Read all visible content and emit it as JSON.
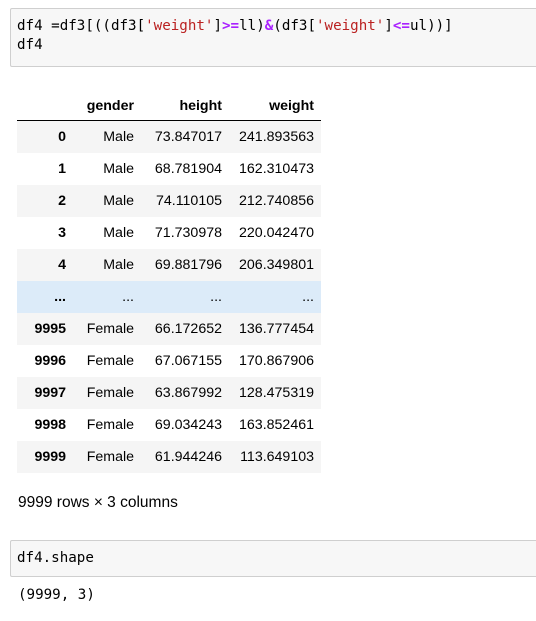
{
  "cells": {
    "input1": {
      "line1": {
        "p1": "df4 =df3[((df3[",
        "s1": "'weight'",
        "p2": "]",
        "o1": ">=",
        "p3": "ll)",
        "o2": "&",
        "p4": "(df3[",
        "s2": "'weight'",
        "p5": "]",
        "o3": "<=",
        "p6": "ul))]"
      },
      "line2": "df4"
    },
    "input2": {
      "line1": "df4.shape"
    }
  },
  "dataframe": {
    "columns": [
      "",
      "gender",
      "height",
      "weight"
    ],
    "rows": [
      {
        "index": "0",
        "gender": "Male",
        "height": "73.847017",
        "weight": "241.893563"
      },
      {
        "index": "1",
        "gender": "Male",
        "height": "68.781904",
        "weight": "162.310473"
      },
      {
        "index": "2",
        "gender": "Male",
        "height": "74.110105",
        "weight": "212.740856"
      },
      {
        "index": "3",
        "gender": "Male",
        "height": "71.730978",
        "weight": "220.042470"
      },
      {
        "index": "4",
        "gender": "Male",
        "height": "69.881796",
        "weight": "206.349801"
      },
      {
        "index": "...",
        "gender": "...",
        "height": "...",
        "weight": "..."
      },
      {
        "index": "9995",
        "gender": "Female",
        "height": "66.172652",
        "weight": "136.777454"
      },
      {
        "index": "9996",
        "gender": "Female",
        "height": "67.067155",
        "weight": "170.867906"
      },
      {
        "index": "9997",
        "gender": "Female",
        "height": "63.867992",
        "weight": "128.475319"
      },
      {
        "index": "9998",
        "gender": "Female",
        "height": "69.034243",
        "weight": "163.852461"
      },
      {
        "index": "9999",
        "gender": "Female",
        "height": "61.944246",
        "weight": "113.649103"
      }
    ],
    "summary": "9999 rows × 3 columns"
  },
  "outputs": {
    "shape": "(9999, 3)"
  }
}
